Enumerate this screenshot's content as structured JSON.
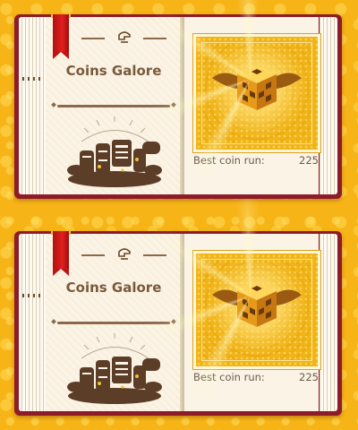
{
  "entries": [
    {
      "title": "Coins Galore",
      "ribbon_color": "#d41616",
      "header_icon": "hat-icon",
      "illustration": "treasure-pile-icon",
      "card_icon": "winged-block-icon",
      "card_color": "#f1b417",
      "stat_label": "Best coin run:",
      "stat_value": "225"
    },
    {
      "title": "Coins Galore",
      "ribbon_color": "#d41616",
      "header_icon": "hat-icon",
      "illustration": "treasure-pile-icon",
      "card_icon": "winged-block-icon",
      "card_color": "#f1b417",
      "stat_label": "Best coin run:",
      "stat_value": "225"
    }
  ],
  "colors": {
    "background": "#f7b417",
    "book_cover": "#8e1b2a",
    "page": "#fbf4e6",
    "ink": "#7a5a3c"
  }
}
